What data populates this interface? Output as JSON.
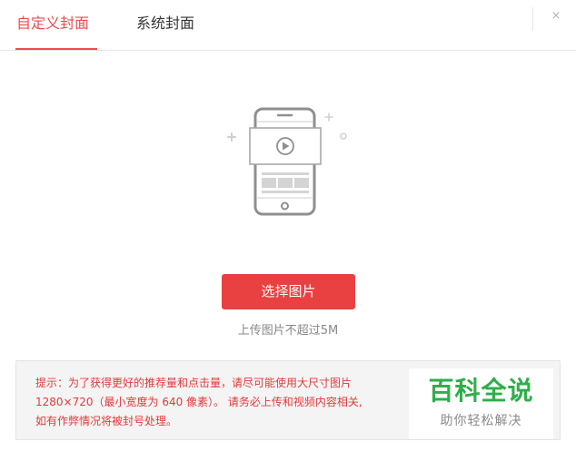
{
  "tabs": [
    {
      "label": "自定义封面",
      "active": true
    },
    {
      "label": "系统封面",
      "active": false
    }
  ],
  "close_label": "×",
  "upload": {
    "button_label": "选择图片",
    "size_hint": "上传图片不超过5M"
  },
  "tip": {
    "line1": "提示：为了获得更好的推荐量和点击量，请尽可能使用大尺寸图片",
    "line2": "1280×720（最小宽度为 640 像素）。 请务必上传和视频内容相关,",
    "line3": "如有作弊情况将被封号处理。"
  },
  "watermark": {
    "title": "百科全说",
    "subtitle": "助你轻松解决"
  },
  "colors": {
    "accent": "#e94142",
    "tip_text": "#e33a3a",
    "watermark_green": "#2eae4a"
  }
}
